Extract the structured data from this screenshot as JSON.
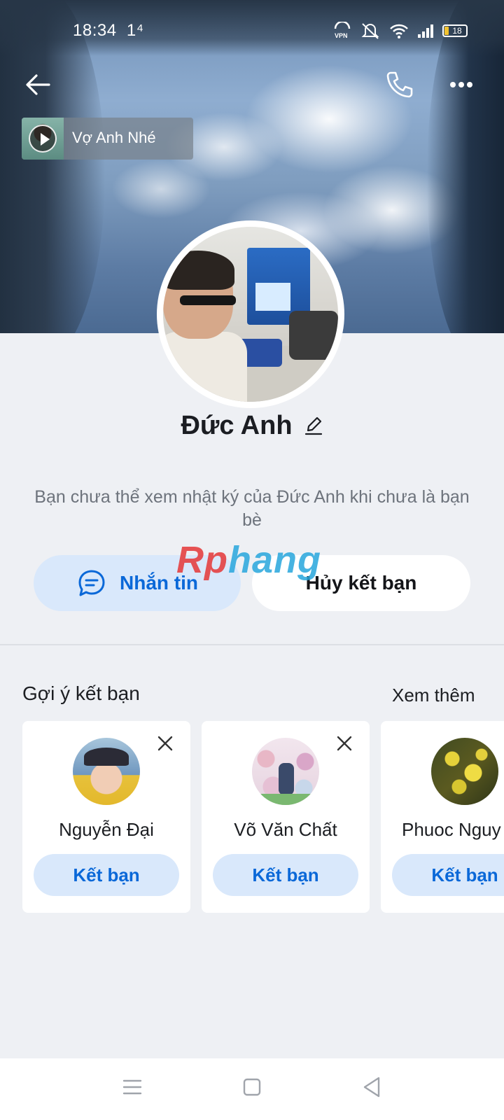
{
  "status_bar": {
    "time": "18:34",
    "activity_indicator": "1⁴",
    "battery": "18",
    "icons": [
      "vpn-icon",
      "mute-icon",
      "wifi-icon",
      "signal-icon",
      "battery-icon"
    ]
  },
  "header": {
    "icons": [
      "back-arrow-icon",
      "phone-icon",
      "more-icon"
    ]
  },
  "music": {
    "title": "Vợ Anh Nhé"
  },
  "profile": {
    "name": "Đức Anh"
  },
  "notice": "Bạn chưa thể xem nhật ký của Đức Anh khi chưa là bạn bè",
  "actions": {
    "message_label": "Nhắn tin",
    "unfriend_label": "Hủy kết bạn"
  },
  "watermark": {
    "part1": "Rp",
    "part2": "hang"
  },
  "suggestions": {
    "title": "Gợi ý kết bạn",
    "see_more": "Xem thêm",
    "items": [
      {
        "name": "Nguyễn Đại",
        "button": "Kết bạn"
      },
      {
        "name": "Võ Văn Chất",
        "button": "Kết bạn"
      },
      {
        "name": "Phuoc Nguy",
        "button": "Kết bạn"
      }
    ]
  },
  "colors": {
    "accent": "#0a68d8",
    "button_bg": "#d9e8fb",
    "background": "#eef0f4"
  }
}
